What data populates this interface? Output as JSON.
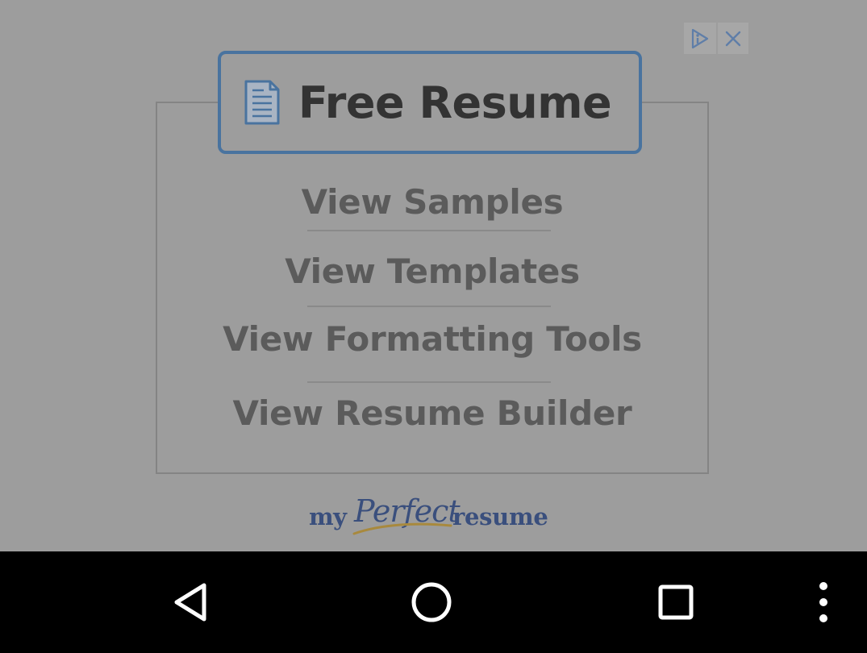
{
  "ad": {
    "header_title": "Free Resume",
    "menu": [
      {
        "label": "View Samples"
      },
      {
        "label": "View Templates"
      },
      {
        "label": "View Formatting Tools"
      },
      {
        "label": "View Resume Builder"
      }
    ],
    "brand": {
      "my": "my",
      "perfect": "Perfect",
      "resume": "resume"
    },
    "badge": {
      "info_icon": "adchoices-icon",
      "close_icon": "close-icon"
    }
  },
  "navbar": {
    "buttons": [
      "back-icon",
      "home-icon",
      "recents-icon",
      "overflow-menu-icon"
    ]
  },
  "colors": {
    "overlay": "#9d9d9d",
    "header_border": "#49739f",
    "brand_text": "#3a4f7d",
    "brand_swoosh": "#a8893d",
    "navbar": "#000000"
  }
}
